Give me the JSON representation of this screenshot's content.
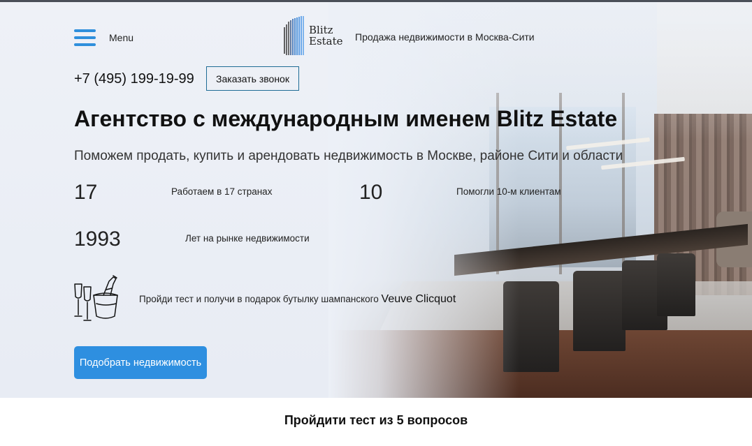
{
  "header": {
    "menu_label": "Menu",
    "logo_line1": "Blitz",
    "logo_line2": "Estate",
    "tagline": "Продажа недвижимости в Москва-Сити"
  },
  "contact": {
    "phone": "+7 (495) 199-19-99",
    "callback_label": "Заказать звонок"
  },
  "hero": {
    "title": "Агентство с международным именем Blitz Estate",
    "subtitle": "Поможем продать, купить и арендовать недвижимость в Москве, районе Сити и области"
  },
  "stats": [
    {
      "number": "17",
      "label": "Работаем в 17 странах"
    },
    {
      "number": "10",
      "label": "Помогли 10-м клиентам"
    },
    {
      "number": "1993",
      "label": "Лет на рынке недвижимости"
    }
  ],
  "promo": {
    "text": "Пройди тест и получи в подарок бутылку шампанского ",
    "brand": "Veuve Clicquot"
  },
  "cta_label": "Подобрать недвижимость",
  "quiz": {
    "title": "Пройдити тест из 5 вопросов"
  },
  "colors": {
    "accent": "#2e8fe0",
    "hero_bg": "#eef1f7",
    "callback_border": "#1f6c95"
  },
  "icons": [
    "burger-menu-icon",
    "logo-bars-icon",
    "champagne-icon"
  ]
}
